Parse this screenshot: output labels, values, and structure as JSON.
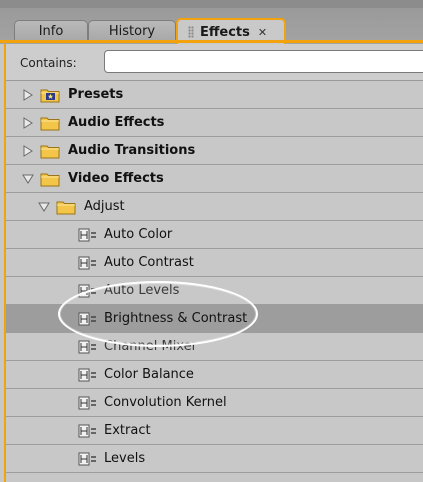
{
  "tabs": [
    {
      "label": "Info",
      "active": false
    },
    {
      "label": "History",
      "active": false
    },
    {
      "label": "Effects",
      "active": true
    }
  ],
  "search": {
    "label": "Contains:",
    "value": ""
  },
  "tree": [
    {
      "label": "Presets",
      "expanded": false,
      "bold": true,
      "icon": "presets-folder-icon"
    },
    {
      "label": "Audio Effects",
      "expanded": false,
      "bold": true,
      "icon": "folder-icon"
    },
    {
      "label": "Audio Transitions",
      "expanded": false,
      "bold": true,
      "icon": "folder-icon"
    },
    {
      "label": "Video Effects",
      "expanded": true,
      "bold": true,
      "icon": "folder-icon"
    },
    {
      "label": "Adjust",
      "expanded": true,
      "bold": false,
      "icon": "folder-icon"
    },
    {
      "label": "Auto Color",
      "icon": "effect-icon"
    },
    {
      "label": "Auto Contrast",
      "icon": "effect-icon"
    },
    {
      "label": "Auto Levels",
      "icon": "effect-icon"
    },
    {
      "label": "Brightness & Contrast",
      "icon": "effect-icon",
      "selected": true
    },
    {
      "label": "Channel Mixer",
      "icon": "effect-icon"
    },
    {
      "label": "Color Balance",
      "icon": "effect-icon"
    },
    {
      "label": "Convolution Kernel",
      "icon": "effect-icon"
    },
    {
      "label": "Extract",
      "icon": "effect-icon"
    },
    {
      "label": "Levels",
      "icon": "effect-icon"
    }
  ],
  "colors": {
    "accent": "#f2a20c",
    "panel": "#c7c7c7",
    "selected_row": "#9d9d9d",
    "folder": "#f2c84a"
  }
}
